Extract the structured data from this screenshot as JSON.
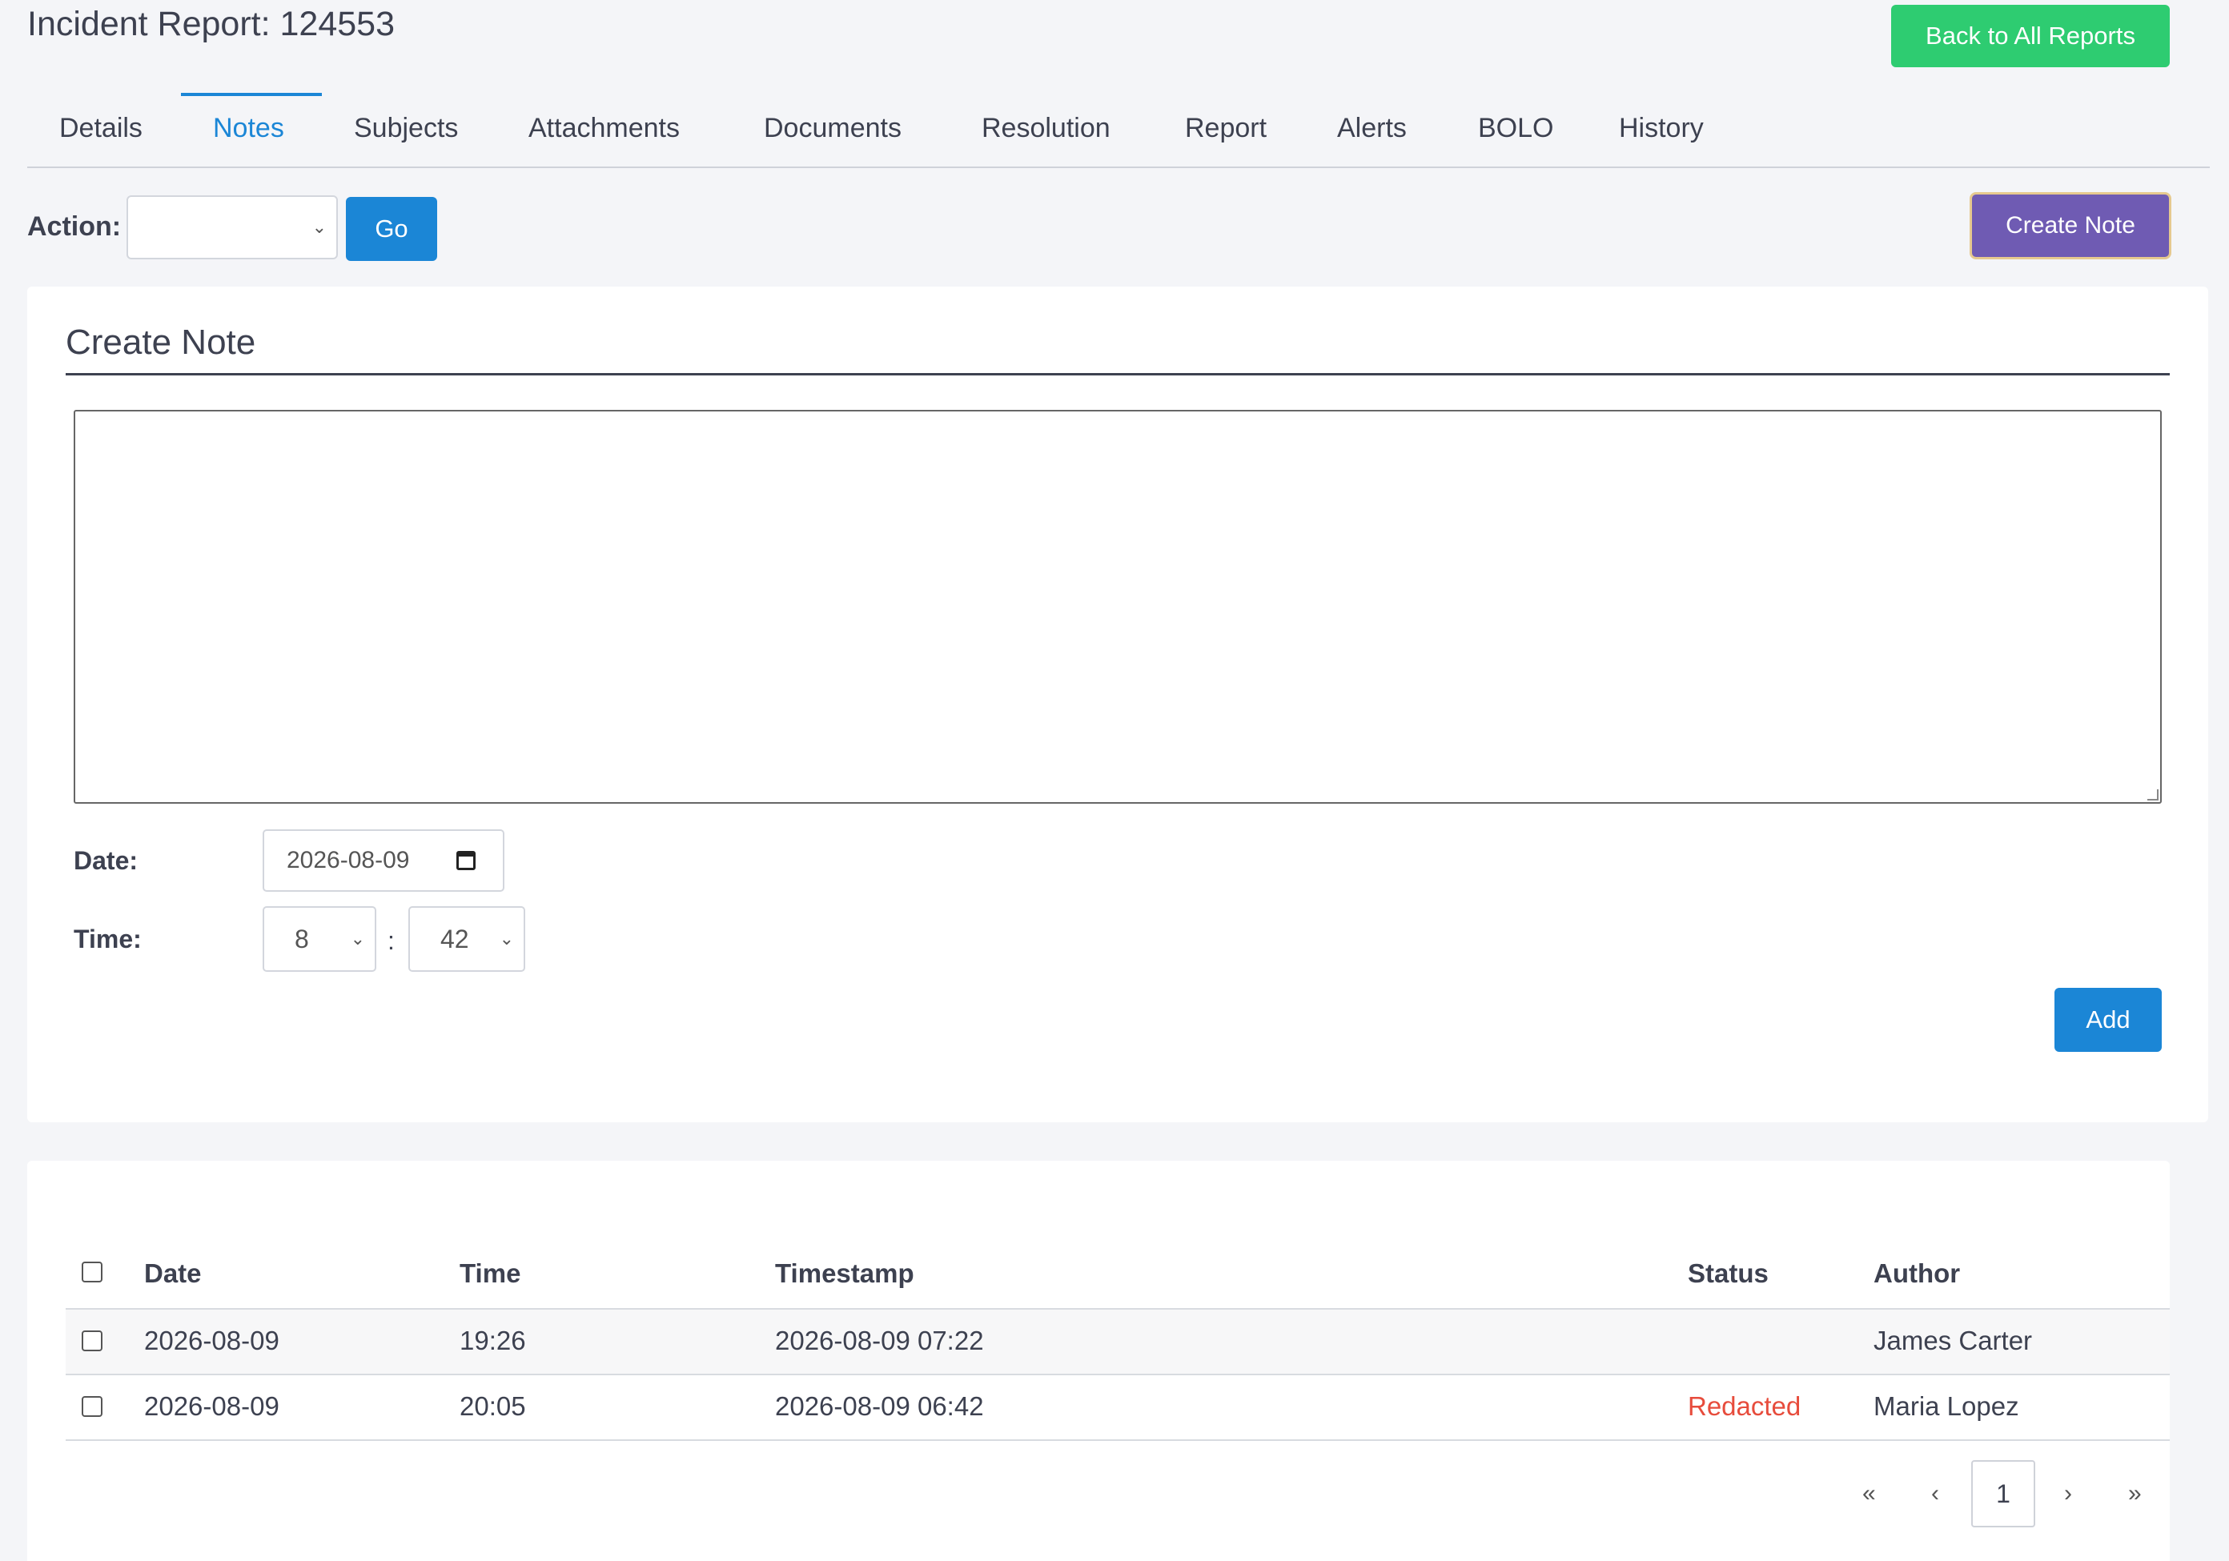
{
  "header": {
    "title": "Incident Report: 124553",
    "back_label": "Back to All Reports"
  },
  "tabs": [
    {
      "label": "Details"
    },
    {
      "label": "Notes",
      "active": true
    },
    {
      "label": "Subjects"
    },
    {
      "label": "Attachments"
    },
    {
      "label": "Documents"
    },
    {
      "label": "Resolution"
    },
    {
      "label": "Report"
    },
    {
      "label": "Alerts"
    },
    {
      "label": "BOLO"
    },
    {
      "label": "History"
    }
  ],
  "action_bar": {
    "action_label": "Action:",
    "action_value": "",
    "go_label": "Go",
    "create_note_label": "Create Note"
  },
  "create_note": {
    "title": "Create Note",
    "note_text": "",
    "date_label": "Date:",
    "date_value": "2026-08-09",
    "time_label": "Time:",
    "hour_value": "8",
    "time_separator": ":",
    "minute_value": "42",
    "add_label": "Add"
  },
  "notes_table": {
    "columns": [
      "Date",
      "Time",
      "Timestamp",
      "Status",
      "Author"
    ],
    "rows": [
      {
        "date": "2026-08-09",
        "time": "19:26",
        "timestamp": "2026-08-09 07:22",
        "status": "",
        "author": "James Carter"
      },
      {
        "date": "2026-08-09",
        "time": "20:05",
        "timestamp": "2026-08-09 06:42",
        "status": "Redacted",
        "author": "Maria Lopez"
      }
    ]
  },
  "pagination": {
    "first": "«",
    "prev": "‹",
    "current": "1",
    "next": "›",
    "last": "»"
  },
  "colors": {
    "primary": "#1b86d6",
    "success": "#2ecc71",
    "purple": "#6f5bb3",
    "danger": "#e74c3c"
  }
}
